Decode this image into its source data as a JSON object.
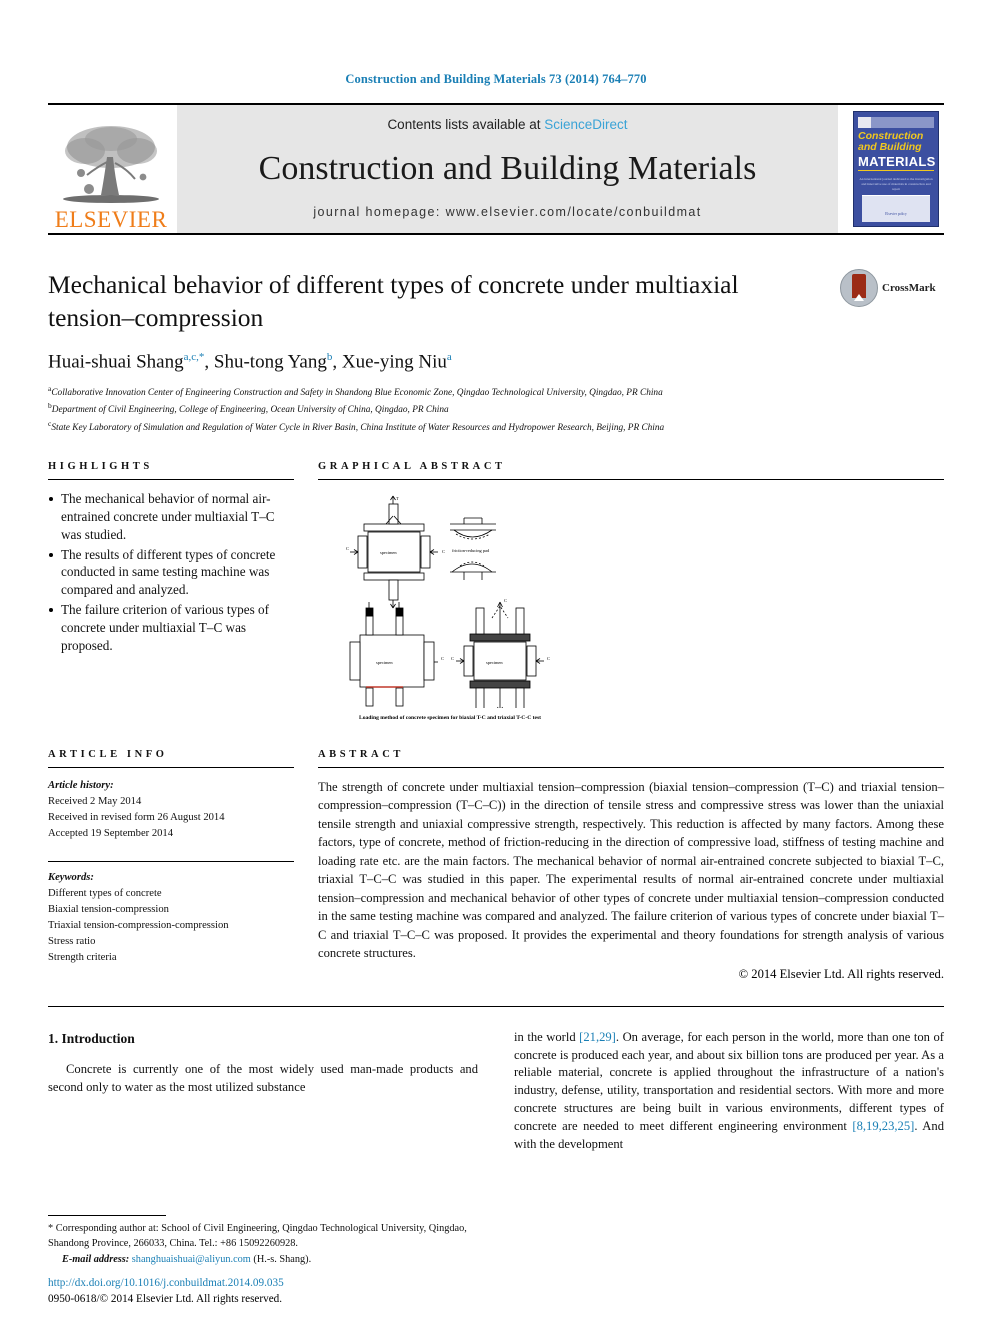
{
  "running_head": "Construction and Building Materials 73 (2014) 764–770",
  "masthead": {
    "publisher_logo_label": "ELSEVIER",
    "contents_prefix": "Contents lists available at ",
    "contents_link": "ScienceDirect",
    "journal_title": "Construction and Building Materials",
    "homepage": "journal homepage: www.elsevier.com/locate/conbuildmat",
    "cover": {
      "line1": "Construction",
      "line2": "and Building",
      "line3": "MATERIALS",
      "blurb": "An international journal dedicated to the investigation and innovative use of materials in construction and repair",
      "footer": "Elsevier policy"
    }
  },
  "article": {
    "title": "Mechanical behavior of different types of concrete under multiaxial tension–compression",
    "authors_html": "Huai-shuai Shang, Shu-tong Yang, Xue-ying Niu",
    "author_list": [
      {
        "name": "Huai-shuai Shang",
        "sup": "a,c,*"
      },
      {
        "name": "Shu-tong Yang",
        "sup": "b"
      },
      {
        "name": "Xue-ying Niu",
        "sup": "a"
      }
    ],
    "affiliations": [
      {
        "mark": "a",
        "text": "Collaborative Innovation Center of Engineering Construction and Safety in Shandong Blue Economic Zone, Qingdao Technological University, Qingdao, PR China"
      },
      {
        "mark": "b",
        "text": "Department of Civil Engineering, College of Engineering, Ocean University of China, Qingdao, PR China"
      },
      {
        "mark": "c",
        "text": "State Key Laboratory of Simulation and Regulation of Water Cycle in River Basin, China Institute of Water Resources and Hydropower Research, Beijing, PR China"
      }
    ],
    "crossmark_label": "CrossMark"
  },
  "highlights": {
    "heading": "HIGHLIGHTS",
    "items": [
      "The mechanical behavior of normal air-entrained concrete under multiaxial T–C was studied.",
      "The results of different types of concrete conducted in same testing machine was compared and analyzed.",
      "The failure criterion of various types of concrete under multiaxial T–C was proposed."
    ]
  },
  "graphical_abstract": {
    "heading": "GRAPHICAL ABSTRACT",
    "caption": "Loading method of concrete specimen for biaxial T-C and triaxial T-C-C test",
    "labels": {
      "specimen": "specimen",
      "tension": "T",
      "compression": "C",
      "friction_pad": "friction-reducing pad"
    }
  },
  "article_info": {
    "heading": "ARTICLE INFO",
    "history_label": "Article history:",
    "history": [
      "Received 2 May 2014",
      "Received in revised form 26 August 2014",
      "Accepted 19 September 2014"
    ],
    "keywords_label": "Keywords:",
    "keywords": [
      "Different types of concrete",
      "Biaxial tension-compression",
      "Triaxial tension-compression-compression",
      "Stress ratio",
      "Strength criteria"
    ]
  },
  "abstract": {
    "heading": "ABSTRACT",
    "text": "The strength of concrete under multiaxial tension–compression (biaxial tension–compression (T–C) and triaxial tension–compression–compression (T–C–C)) in the direction of tensile stress and compressive stress was lower than the uniaxial tensile strength and uniaxial compressive strength, respectively. This reduction is affected by many factors. Among these factors, type of concrete, method of friction-reducing in the direction of compressive load, stiffness of testing machine and loading rate etc. are the main factors. The mechanical behavior of normal air-entrained concrete subjected to biaxial T–C, triaxial T–C–C was studied in this paper. The experimental results of normal air-entrained concrete under multiaxial tension–compression and mechanical behavior of other types of concrete under multiaxial tension–compression conducted in the same testing machine was compared and analyzed. The failure criterion of various types of concrete under biaxial T–C and triaxial T–C–C was proposed. It provides the experimental and theory foundations for strength analysis of various concrete structures.",
    "copyright": "© 2014 Elsevier Ltd. All rights reserved."
  },
  "introduction": {
    "heading": "1. Introduction",
    "left_paragraph": "Concrete is currently one of    the most widely used man-made products and second only to water as the most utilized substance",
    "right_pre1": "in the world ",
    "right_ref1": "[21,29]",
    "right_mid1": ". On average, for each person in the world, more than one ton of concrete is produced each year, and about six billion tons are produced per year. As a reliable material, concrete is applied throughout the infrastructure of a nation's industry, defense, utility, transportation and residential sectors. With more and more concrete structures are being built in various environments, different types of concrete are needed to meet different engineering environment ",
    "right_ref2": "[8,19,23,25]",
    "right_tail": ". And with the development"
  },
  "footnotes": {
    "corresponding": "* Corresponding author at: School of Civil Engineering, Qingdao Technological University, Qingdao, Shandong Province, 266033, China. Tel.: +86 15092260928.",
    "email_label": "E-mail address:",
    "email": "shanghuaishuai@aliyun.com",
    "email_suffix": "(H.-s. Shang).",
    "doi": "http://dx.doi.org/10.1016/j.conbuildmat.2014.09.035",
    "issn_line": "0950-0618/© 2014 Elsevier Ltd. All rights reserved."
  },
  "colors": {
    "link_blue": "#1a7fb5",
    "sciencedirect_blue": "#3aa3d6",
    "elsevier_orange": "#ef7d1a",
    "cover_blue": "#3c4fa0",
    "cover_yellow": "#f2c81e"
  }
}
